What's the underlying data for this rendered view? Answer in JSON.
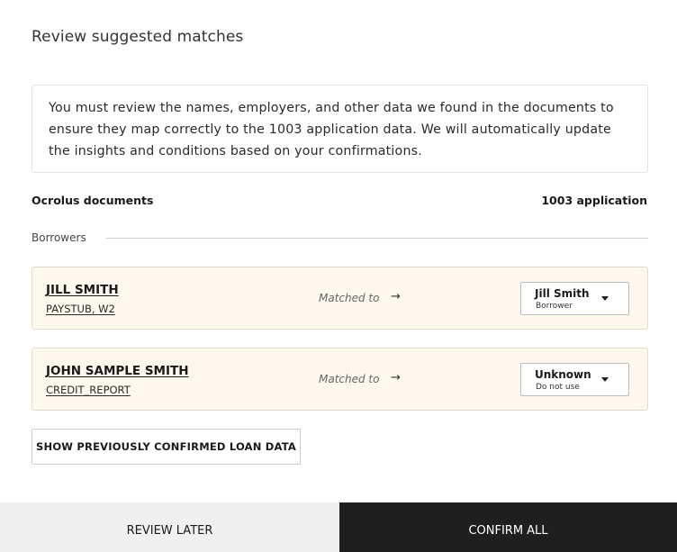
{
  "page_title": "Review suggested matches",
  "info_text": "You must review the names, employers, and other data we found in the documents to ensure they map correctly to the 1003 application data. We will automatically update the insights and conditions based on your confirmations.",
  "columns": {
    "left": "Ocrolus documents",
    "right": "1003 application"
  },
  "section": {
    "label": "Borrowers"
  },
  "matches": [
    {
      "doc_name": "JILL SMITH",
      "doc_types": "PAYSTUB, W2",
      "matched_label": "Matched to",
      "arrow": "→",
      "selected_value": "Jill Smith",
      "selected_sub": "Borrower"
    },
    {
      "doc_name": "JOHN SAMPLE SMITH",
      "doc_types": "CREDIT_REPORT",
      "matched_label": "Matched to",
      "arrow": "→",
      "selected_value": "Unknown",
      "selected_sub": "Do not use"
    }
  ],
  "show_button_label": "SHOW PREVIOUSLY CONFIRMED LOAN DATA",
  "footer": {
    "review_later_label": "REVIEW LATER",
    "confirm_all_label": "CONFIRM ALL"
  },
  "colors": {
    "card_background": "#fcf8ee",
    "confirm_background": "#1f1f1f",
    "later_background": "#f0f0f0"
  }
}
